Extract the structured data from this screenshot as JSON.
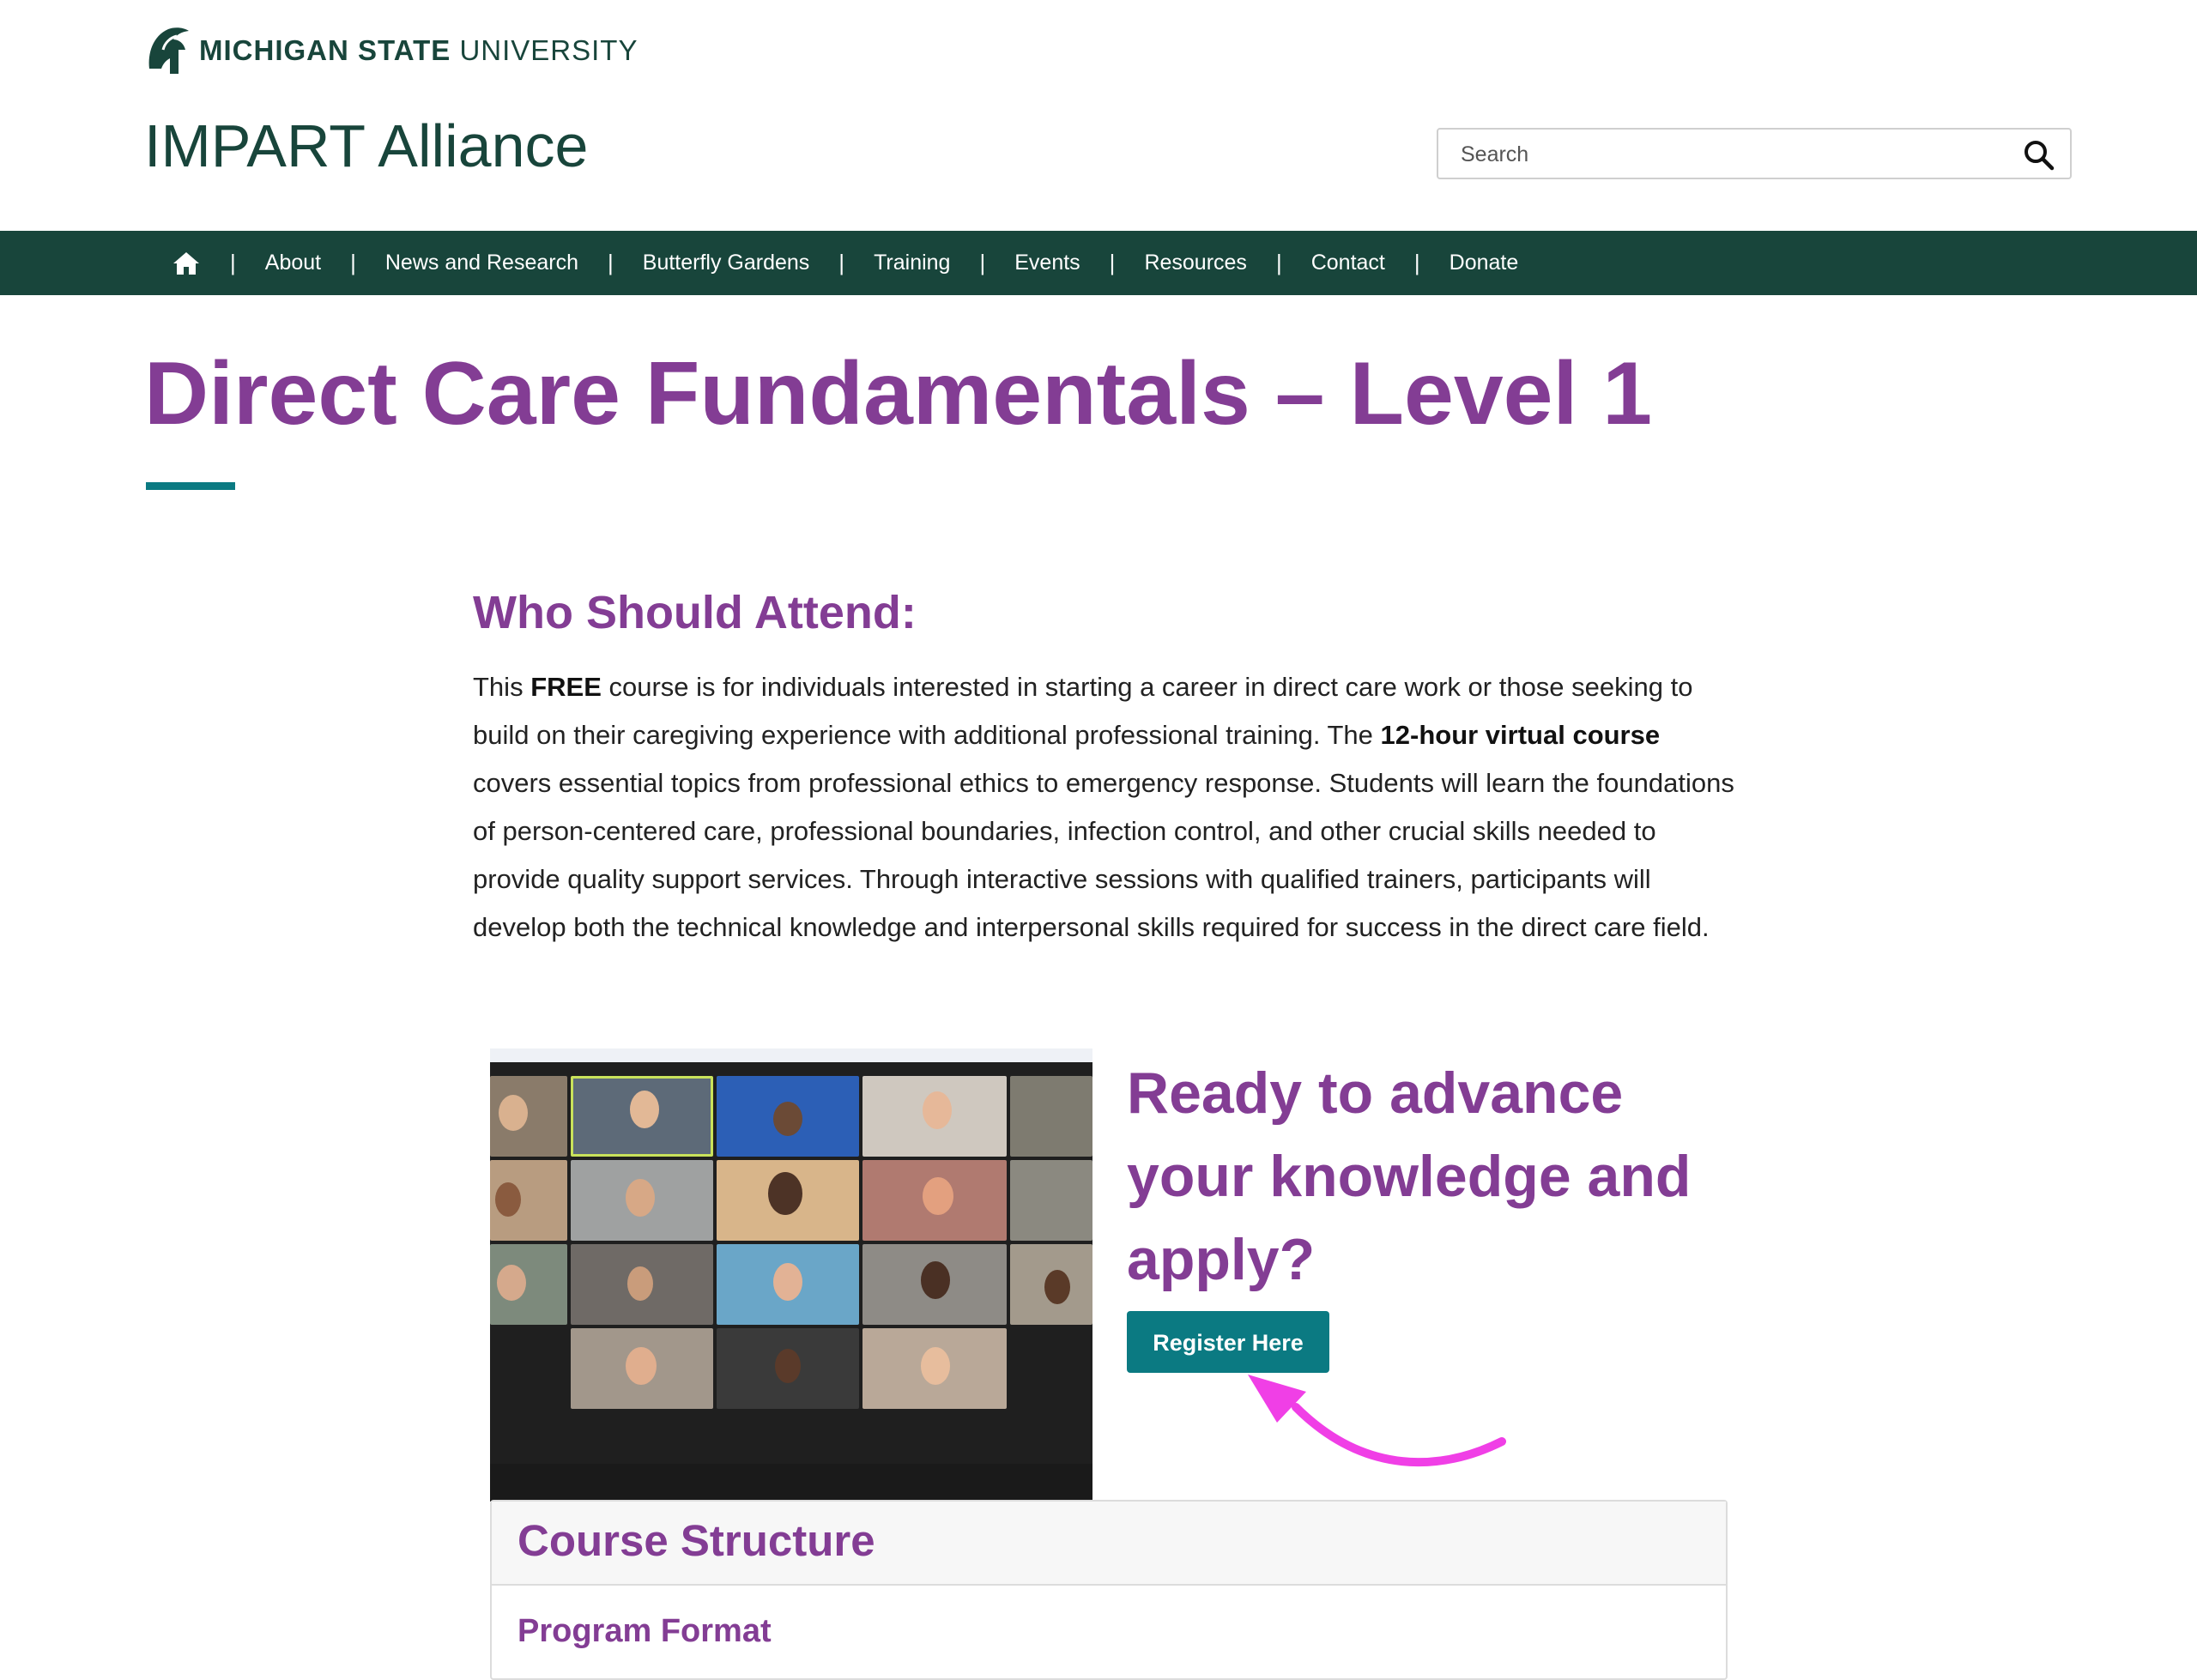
{
  "header": {
    "university_strong": "MICHIGAN STATE",
    "university_light": "UNIVERSITY",
    "site_title": "IMPART Alliance",
    "search_placeholder": "Search"
  },
  "nav": {
    "items": [
      "About",
      "News and Research",
      "Butterfly Gardens",
      "Training",
      "Events",
      "Resources",
      "Contact",
      "Donate"
    ]
  },
  "page": {
    "title": "Direct Care Fundamentals – Level 1"
  },
  "attend": {
    "heading": "Who Should Attend:",
    "p1": "This ",
    "p1_bold": "FREE",
    "p2": " course is for individuals interested in starting a career in direct care work or those seeking to build on their caregiving experience with additional professional training. The ",
    "p2_bold": "12-hour virtual course",
    "p3": " covers essential topics from professional ethics to emergency response. Students will learn the foundations of person-centered care, professional boundaries, infection control, and other crucial skills needed to provide quality support services. Through interactive sessions with qualified trainers, participants will develop both the technical knowledge and interpersonal skills required for success in the direct care field."
  },
  "cta": {
    "heading": "Ready to advance your knowledge and apply?",
    "button": "Register Here"
  },
  "course": {
    "heading": "Course Structure",
    "subheading": "Program Format"
  },
  "colors": {
    "green": "#18453B",
    "purple": "#833D94",
    "teal": "#0B7A82",
    "arrow": "#F03FE6"
  }
}
